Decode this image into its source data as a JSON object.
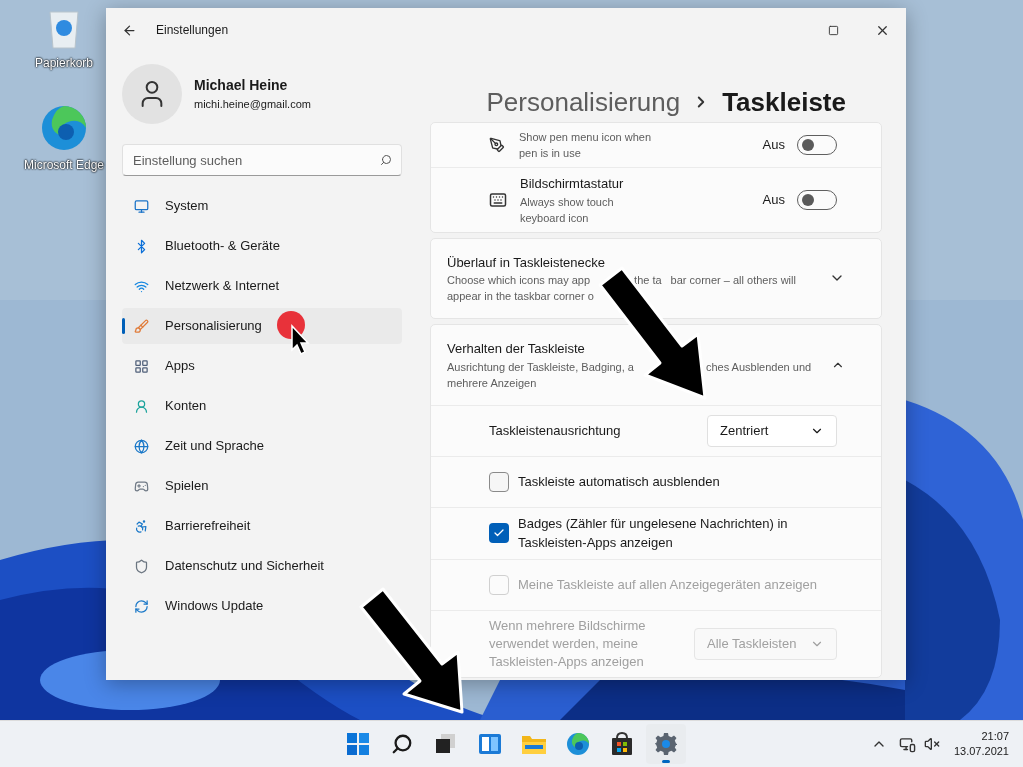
{
  "desktop_icons": [
    {
      "kind": "recycle",
      "label": "Papierkorb"
    },
    {
      "kind": "edge",
      "label": "Microsoft Edge"
    }
  ],
  "window": {
    "title": "Einstellungen",
    "user": {
      "name": "Michael Heine",
      "email": "michi.heine@gmail.com"
    },
    "search": {
      "placeholder": "Einstellung suchen"
    },
    "nav": [
      {
        "label": "System",
        "selected": false
      },
      {
        "label": "Bluetooth- & Geräte",
        "selected": false
      },
      {
        "label": "Netzwerk & Internet",
        "selected": false
      },
      {
        "label": "Personalisierung",
        "selected": true
      },
      {
        "label": "Apps",
        "selected": false
      },
      {
        "label": "Konten",
        "selected": false
      },
      {
        "label": "Zeit und Sprache",
        "selected": false
      },
      {
        "label": "Spielen",
        "selected": false
      },
      {
        "label": "Barrierefreiheit",
        "selected": false
      },
      {
        "label": "Datenschutz und Sicherheit",
        "selected": false
      },
      {
        "label": "Windows Update",
        "selected": false
      }
    ],
    "breadcrumb": [
      "Personalisierung",
      "Taskleiste"
    ],
    "cards": [
      {
        "rows": [
          {
            "kind": "toggle",
            "description": "Show pen menu icon when pen is in use",
            "state_label": "Aus",
            "on": false
          },
          {
            "kind": "toggle",
            "title": "Bildschirmtastatur",
            "description": "Always show touch keyboard icon",
            "state_label": "Aus",
            "on": false
          }
        ]
      },
      {
        "title": "Überlauf in Taskleistenecke",
        "description_lines": [
          [
            "Choose which icons may app",
            "the ta",
            "bar corner – all others will"
          ],
          [
            "appear in the taskbar corner o"
          ]
        ],
        "expanded": false
      },
      {
        "title": "Verhalten der Taskleiste",
        "description_lines": [
          [
            "Ausrichtung der Taskleiste, Badging, a",
            "ches Ausblenden und"
          ],
          [
            "mehrere Anzeigen"
          ]
        ],
        "expanded": true,
        "rows": [
          {
            "kind": "dropdown",
            "label": "Taskleistenausrichtung",
            "value": "Zentriert",
            "disabled": false
          },
          {
            "kind": "checkbox",
            "label": "Taskleiste automatisch ausblenden",
            "checked": false,
            "disabled": false
          },
          {
            "kind": "checkbox",
            "label": "Badges (Zähler für ungelesene Nachrichten) in Taskleisten-Apps anzeigen",
            "checked": true,
            "disabled": false
          },
          {
            "kind": "checkbox",
            "label": "Meine Taskleiste auf allen Anzeigegeräten anzeigen",
            "checked": false,
            "disabled": true
          },
          {
            "kind": "dropdown",
            "label": "Wenn mehrere Bildschirme verwendet werden, meine Taskleisten-Apps anzeigen",
            "value": "Alle Taskleisten",
            "disabled": true
          }
        ]
      }
    ]
  },
  "taskbar": {
    "apps": [
      {
        "kind": "start",
        "selected": false
      },
      {
        "kind": "search",
        "selected": false
      },
      {
        "kind": "taskview",
        "selected": false
      },
      {
        "kind": "widgets",
        "selected": false
      },
      {
        "kind": "explorer",
        "selected": false
      },
      {
        "kind": "edge",
        "selected": false
      },
      {
        "kind": "store",
        "selected": false
      },
      {
        "kind": "settings",
        "selected": true
      }
    ],
    "time": "21:07",
    "date": "13.07.2021"
  }
}
